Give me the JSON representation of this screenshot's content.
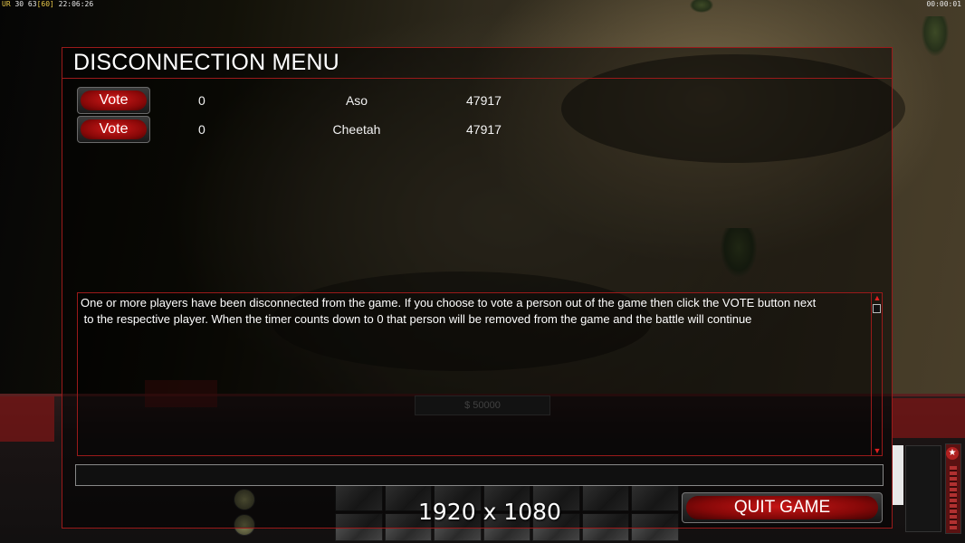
{
  "hud": {
    "top_left_prefix": "UR",
    "top_left_stats": "30 63",
    "top_left_fps": "[60]",
    "top_left_time": "22:06:26",
    "top_right_timer": "00:00:01"
  },
  "background_ui": {
    "cash": "$ 50000"
  },
  "dialog": {
    "title": "DISCONNECTION MENU",
    "players": [
      {
        "vote_label": "Vote",
        "votes": "0",
        "name": "Aso",
        "ping": "47917"
      },
      {
        "vote_label": "Vote",
        "votes": "0",
        "name": "Cheetah",
        "ping": "47917"
      }
    ],
    "message": "One or more players have been disconnected from the game. If you choose to vote a person out of the game then click the VOTE button next\n to the respective player. When the timer counts down to 0 that person will be removed from the game and the battle will continue",
    "chat_value": "",
    "quit_label": "QUIT GAME"
  },
  "overlay": {
    "resolution_label": "1920 x 1080"
  },
  "colors": {
    "accent_red": "#9a1a1a",
    "button_red": "#c81616"
  }
}
